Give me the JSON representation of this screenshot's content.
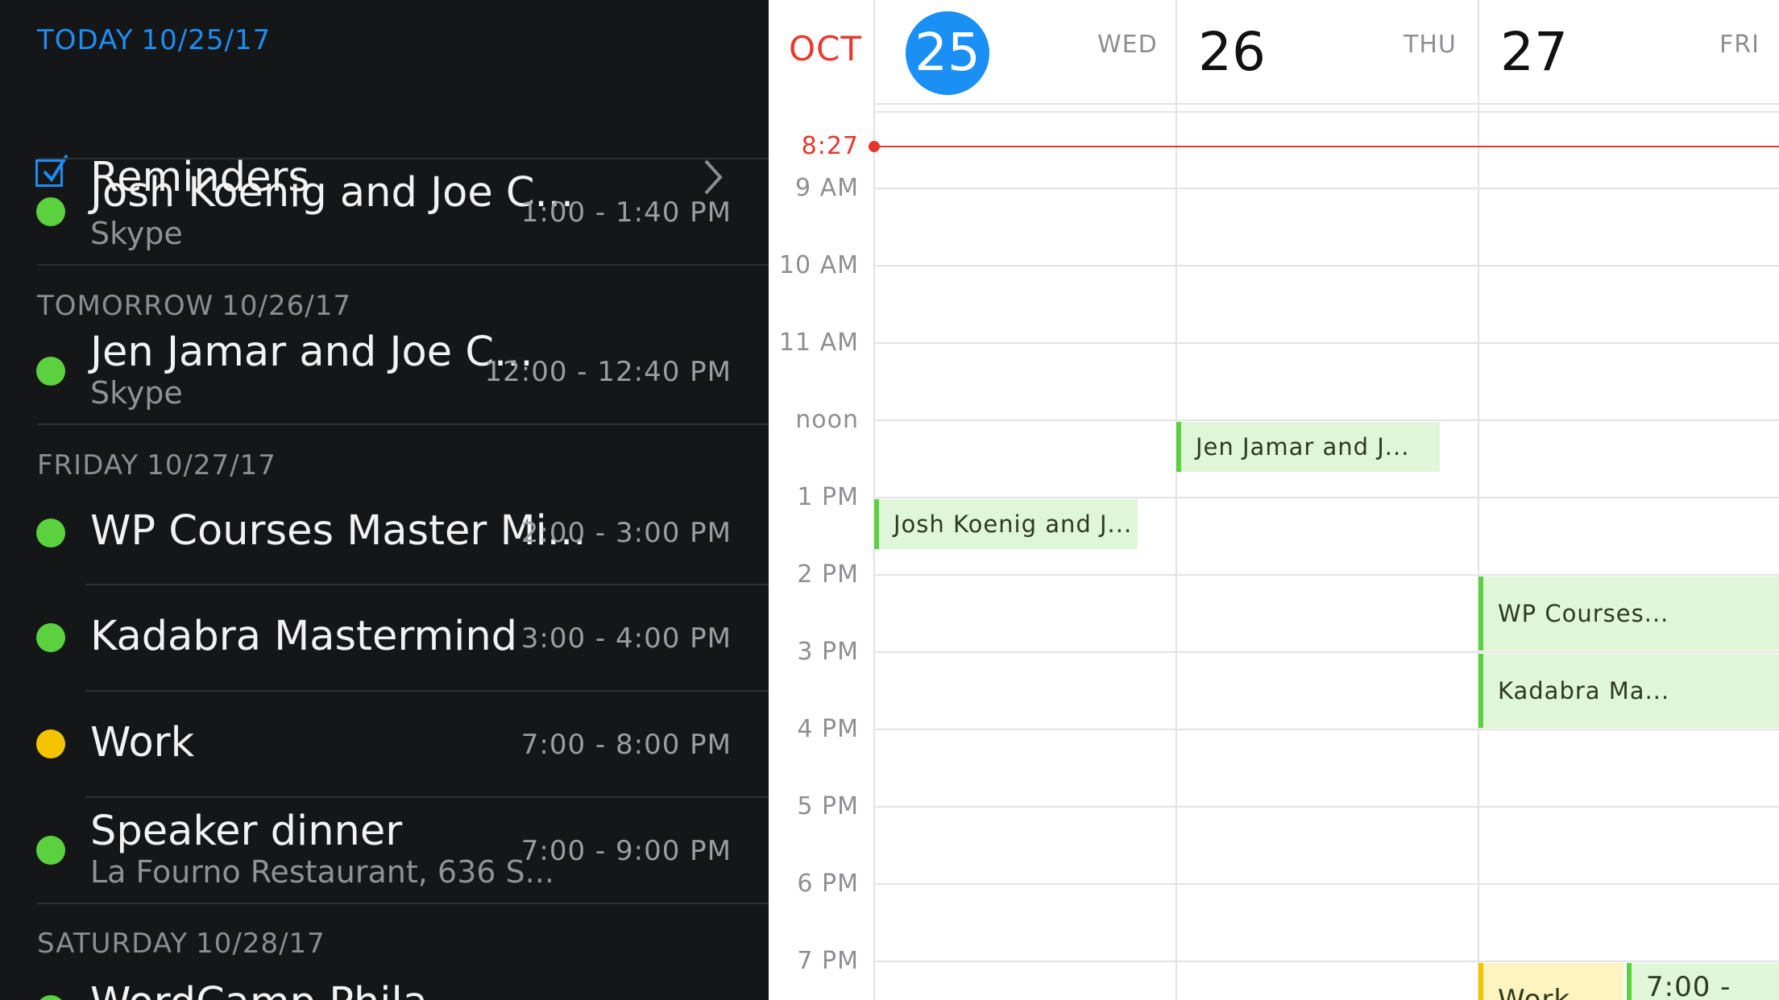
{
  "agenda": {
    "today_header": {
      "label": "TODAY",
      "date": "10/25/17"
    },
    "reminders": {
      "label": "Reminders"
    },
    "days": [
      {
        "label": "",
        "date": ""
      },
      {
        "label": "TOMORROW",
        "date": "10/26/17"
      },
      {
        "label": "FRIDAY",
        "date": "10/27/17"
      },
      {
        "label": "SATURDAY",
        "date": "10/28/17"
      }
    ],
    "events": [
      {
        "title": "Josh Koenig and Joe C...",
        "subtitle": "Skype",
        "time": "1:00 - 1:40 PM",
        "color": "#5cd13f"
      },
      {
        "title": "Jen Jamar and Joe C...",
        "subtitle": "Skype",
        "time": "12:00 - 12:40 PM",
        "color": "#5cd13f"
      },
      {
        "title": "WP Courses Master Mi...",
        "subtitle": "",
        "time": "2:00 - 3:00 PM",
        "color": "#5cd13f"
      },
      {
        "title": "Kadabra Mastermind",
        "subtitle": "",
        "time": "3:00 - 4:00 PM",
        "color": "#5cd13f"
      },
      {
        "title": "Work",
        "subtitle": "",
        "time": "7:00 - 8:00 PM",
        "color": "#f5c400"
      },
      {
        "title": "Speaker dinner",
        "subtitle": "La Fourno Restaurant, 636 S...",
        "time": "7:00 - 9:00 PM",
        "color": "#5cd13f"
      },
      {
        "title": "WordCamp Phila...",
        "subtitle": "",
        "time": "",
        "color": "#5cd13f"
      }
    ]
  },
  "calendar": {
    "month": "OCT",
    "days": [
      {
        "num": "25",
        "name": "WED"
      },
      {
        "num": "26",
        "name": "THU"
      },
      {
        "num": "27",
        "name": "FRI"
      }
    ],
    "now": "8:27",
    "hours": [
      "9 AM",
      "10 AM",
      "11 AM",
      "noon",
      "1 PM",
      "2 PM",
      "3 PM",
      "4 PM",
      "5 PM",
      "6 PM",
      "7 PM"
    ],
    "events": [
      {
        "title": "Jen Jamar and J..."
      },
      {
        "title": "Josh Koenig and J..."
      },
      {
        "title": "WP Courses..."
      },
      {
        "title": "Kadabra Ma..."
      },
      {
        "title": "Work"
      },
      {
        "title": "7:00 -"
      }
    ]
  },
  "colors": {
    "accent": "#1a8ff4",
    "now": "#e6362c",
    "green": "#5cd13f",
    "yellow": "#f5c400"
  }
}
